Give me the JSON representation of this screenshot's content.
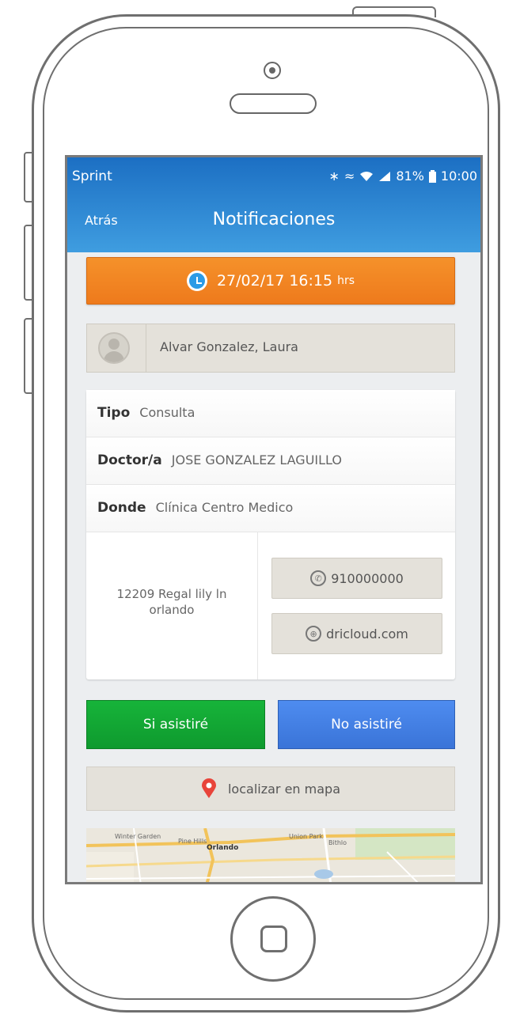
{
  "status_bar": {
    "carrier": "Sprint",
    "battery": "81%",
    "time": "10:00",
    "icons": [
      "bluetooth-icon",
      "nfc-icon",
      "wifi-icon",
      "signal-icon",
      "battery-icon"
    ]
  },
  "nav": {
    "back_label": "Atrás",
    "title": "Notificaciones"
  },
  "appointment": {
    "date_time": "27/02/17  16:15",
    "hrs_suffix": "hrs",
    "patient_name": "Alvar Gonzalez, Laura",
    "rows": [
      {
        "label": "Tipo",
        "value": "Consulta"
      },
      {
        "label": "Doctor/a",
        "value": "JOSE GONZALEZ LAGUILLO"
      },
      {
        "label": "Donde",
        "value": "Clínica Centro Medico"
      }
    ],
    "address_line1": "12209 Regal lily ln",
    "address_line2": "orlando",
    "phone": "910000000",
    "website": "dricloud.com"
  },
  "actions": {
    "yes_label": "Si asistiré",
    "no_label": "No asistiré",
    "map_label": "localizar en mapa"
  },
  "map": {
    "labels": [
      "Winter Garden",
      "Pine Hills",
      "Orlando",
      "Union Park",
      "Bithlo"
    ]
  },
  "colors": {
    "header_blue": "#1c6fc3",
    "orange": "#f5912a",
    "green": "#17b43a",
    "blue_button": "#4e8cf0",
    "pin_red": "#e8443a"
  }
}
